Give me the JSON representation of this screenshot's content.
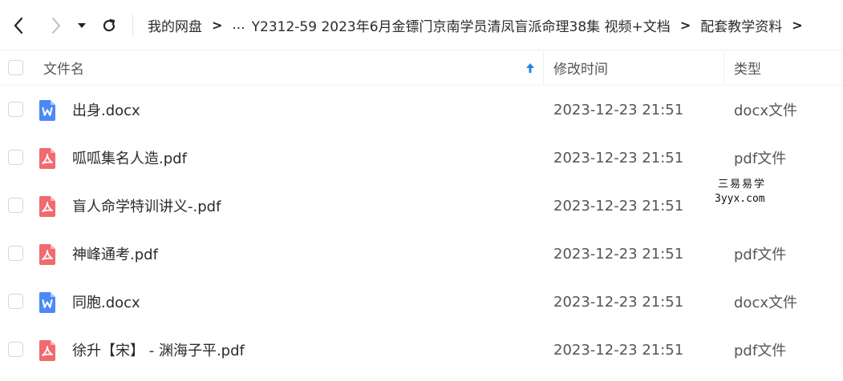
{
  "breadcrumb": {
    "items": [
      "我的网盘",
      "...",
      "Y2312-59 2023年6月金镖门京南学员清凤盲派命理38集 视频+文档",
      "配套教学资料"
    ],
    "separator": ">"
  },
  "columns": {
    "name": "文件名",
    "modified": "修改时间",
    "type": "类型"
  },
  "files": [
    {
      "name": "出身.docx",
      "modified": "2023-12-23 21:51",
      "type": "docx文件",
      "icon": "word-doc-icon"
    },
    {
      "name": "呱呱集名人造.pdf",
      "modified": "2023-12-23 21:51",
      "type": "pdf文件",
      "icon": "pdf-icon"
    },
    {
      "name": "盲人命学特训讲义-.pdf",
      "modified": "2023-12-23 21:51",
      "type": "pdf文件",
      "icon": "pdf-icon"
    },
    {
      "name": "神峰通考.pdf",
      "modified": "2023-12-23 21:51",
      "type": "pdf文件",
      "icon": "pdf-icon"
    },
    {
      "name": "同胞.docx",
      "modified": "2023-12-23 21:51",
      "type": "docx文件",
      "icon": "word-doc-icon"
    },
    {
      "name": "徐升【宋】 - 渊海子平.pdf",
      "modified": "2023-12-23 21:51",
      "type": "pdf文件",
      "icon": "pdf-icon"
    }
  ],
  "watermark": {
    "line1": "三易易学",
    "line2": "3yyx.com"
  },
  "colors": {
    "word": "#4a8af4",
    "pdf": "#f2696f",
    "sort_arrow": "#1e88e5"
  }
}
